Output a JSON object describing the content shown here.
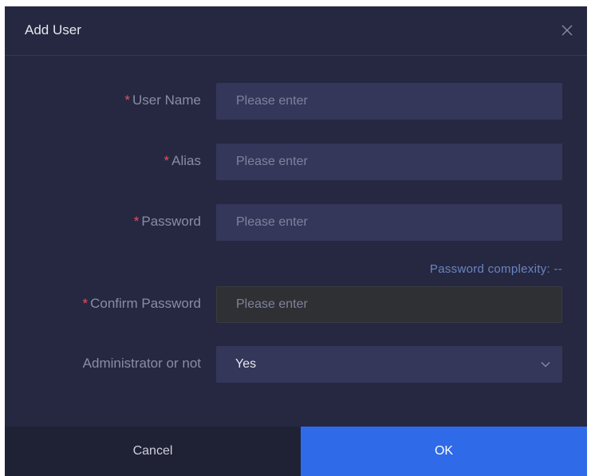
{
  "dialog": {
    "title": "Add User",
    "close_icon": "close-icon"
  },
  "form": {
    "required_mark": "*",
    "username": {
      "label": "User Name",
      "placeholder": "Please enter",
      "value": ""
    },
    "alias": {
      "label": "Alias",
      "placeholder": "Please enter",
      "value": ""
    },
    "password": {
      "label": "Password",
      "placeholder": "Please enter",
      "value": ""
    },
    "complexity": {
      "text": "Password complexity: --"
    },
    "confirm_password": {
      "label": "Confirm Password",
      "placeholder": "Please enter",
      "value": ""
    },
    "administrator": {
      "label": "Administrator or not",
      "selected": "Yes",
      "chevron_icon": "chevron-down-icon"
    }
  },
  "footer": {
    "cancel_label": "Cancel",
    "ok_label": "OK"
  },
  "colors": {
    "dialog_bg": "#252840",
    "input_bg": "#34375a",
    "required": "#e8505b",
    "primary": "#2f6ae8",
    "cancel_bg": "#1f2135",
    "complexity_text": "#6b85c2"
  }
}
